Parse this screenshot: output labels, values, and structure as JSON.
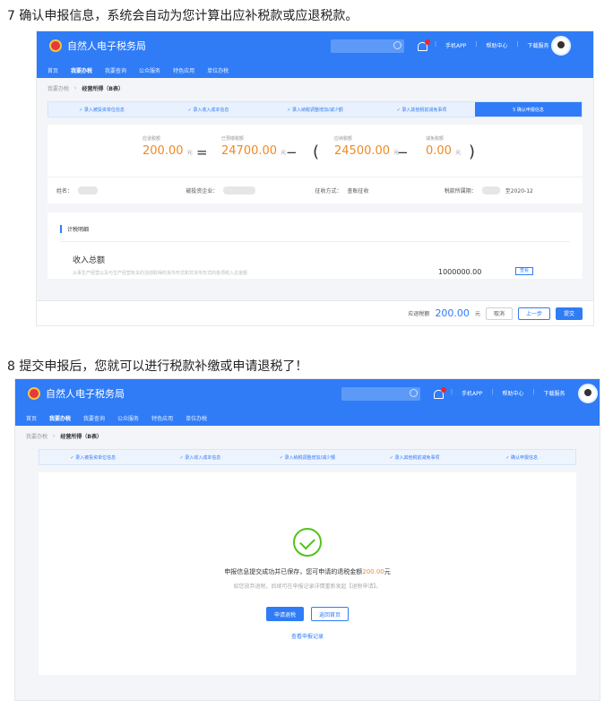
{
  "step7": {
    "heading": "7 确认申报信息，系统会自动为您计算出应补税款或应退税款。",
    "app_name": "自然人电子税务局",
    "top_links": [
      "手机APP",
      "帮助中心",
      "下载服务"
    ],
    "nav": [
      "首页",
      "我要办税",
      "我要查询",
      "公众服务",
      "特色应用",
      "单位办税"
    ],
    "breadcrumb": [
      "我要办税",
      "经营所得（B表）"
    ],
    "steps": [
      "✓ 录入被投资单位信息",
      "✓ 录入收入成本信息",
      "✓ 录入纳税调整增加/减少额",
      "✓ 录入其他税前减免事项",
      "5 确认申报信息"
    ],
    "calc": {
      "label_due": "应退税额",
      "value_due": "200.00",
      "label_prepaid": "已预缴税额",
      "value_prepaid": "24700.00",
      "label_payable": "应纳税额",
      "value_payable": "24500.00",
      "label_reduction": "减免税额",
      "value_reduction": "0.00",
      "unit": "元",
      "op_eq": "=",
      "op_minus": "−",
      "paren_open": "(",
      "paren_close": ")"
    },
    "info": {
      "name_label": "姓名：",
      "enterprise_label": "被投资企业：",
      "method_label": "征收方式：",
      "method_value": "查账征收",
      "period_label": "税款所属期：",
      "period_value": "至2020-12"
    },
    "detail": {
      "header": "计税明细",
      "title": "收入总额",
      "desc": "从事生产经营以及与生产经营有关的活动取得的货币形式和非货币形式的各项收入总金额",
      "amount": "1000000.00",
      "mini_btn": "查看"
    },
    "footer": {
      "label": "应退税额",
      "amount": "200.00",
      "unit": "元",
      "cancel": "取消",
      "prev": "上一步",
      "submit": "提交"
    }
  },
  "step8": {
    "heading": "8 提交申报后，您就可以进行税款补缴或申请退税了！",
    "app_name": "自然人电子税务局",
    "top_links": [
      "手机APP",
      "帮助中心",
      "下载服务"
    ],
    "nav": [
      "首页",
      "我要办税",
      "我要查询",
      "公众服务",
      "特色应用",
      "单位办税"
    ],
    "breadcrumb": [
      "我要办税",
      "经营所得（B表）"
    ],
    "steps": [
      "✓ 录入被投资单位信息",
      "✓ 录入收入成本信息",
      "✓ 录入纳税调整增加/减少额",
      "✓ 录入其他税前减免事项",
      "✓ 确认申报信息"
    ],
    "msg_prefix": "申报信息提交成功并已保存，您可申请的退税金额",
    "msg_amount": "200.00",
    "msg_suffix": "元",
    "msg2": "如您放弃退税，后续可在申报记录详情重新发起【退税申请】。",
    "apply_refund": "申请退税",
    "back_home": "返回首页",
    "view_records": "查看申报记录"
  }
}
